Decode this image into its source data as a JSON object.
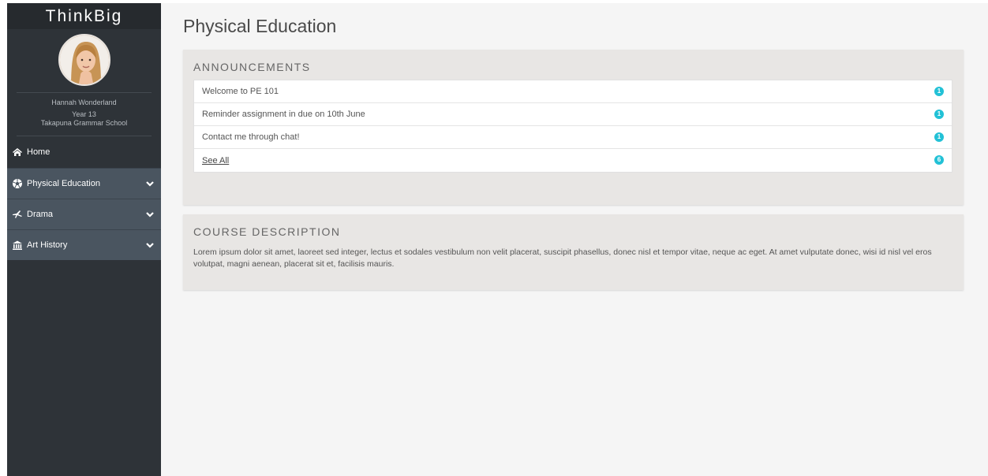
{
  "app": {
    "brand": "ThinkBig"
  },
  "profile": {
    "name": "Hannah Wonderland",
    "year": "Year 13",
    "school": "Takapuna Grammar School"
  },
  "nav": {
    "home": "Home",
    "items": [
      {
        "label": "Physical Education",
        "icon": "soccer-ball-icon"
      },
      {
        "label": "Drama",
        "icon": "theater-icon"
      },
      {
        "label": "Art History",
        "icon": "museum-icon"
      }
    ]
  },
  "page": {
    "title": "Physical Education"
  },
  "announcements": {
    "title": "ANNOUNCEMENTS",
    "items": [
      {
        "text": "Welcome to PE 101",
        "count": "1"
      },
      {
        "text": "Reminder assignment in due on 10th June",
        "count": "1"
      },
      {
        "text": "Contact me through chat!",
        "count": "1"
      }
    ],
    "see_all": {
      "text": "See All",
      "count": "6"
    }
  },
  "course": {
    "title": "COURSE DESCRIPTION",
    "text": "Lorem ipsum dolor sit amet, laoreet sed integer, lectus et sodales vestibulum non velit placerat, suscipit phasellus, donec nisl et tempor vitae, neque ac eget. At amet vulputate donec, wisi id nisl vel eros volutpat, magni aenean, placerat sit et, facilisis mauris."
  },
  "colors": {
    "sidebar": "#2e3338",
    "nav_active": "#4a5560",
    "badge": "#22c1d6"
  }
}
